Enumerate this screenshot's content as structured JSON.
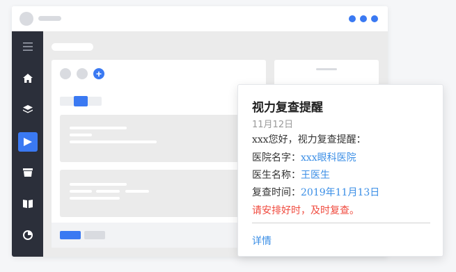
{
  "colors": {
    "accent": "#3a79f2",
    "sidebar_bg": "#2b2f3a",
    "link": "#3a8ee6",
    "warning": "#f04a3e"
  },
  "window": {
    "controls": [
      "dot",
      "dot",
      "dot"
    ]
  },
  "sidebar": {
    "items": [
      {
        "icon": "menu-icon",
        "active": false
      },
      {
        "icon": "home-icon",
        "active": false
      },
      {
        "icon": "layers-icon",
        "active": false
      },
      {
        "icon": "play-icon",
        "active": true
      },
      {
        "icon": "box-icon",
        "active": false
      },
      {
        "icon": "book-icon",
        "active": false
      },
      {
        "icon": "pie-chart-icon",
        "active": false
      }
    ]
  },
  "toolbar": {
    "add_icon": "plus-icon",
    "plus_glyph": "+"
  },
  "notification": {
    "title": "视力复查提醒",
    "date": "11月12日",
    "greeting": "xxx您好，视力复查提醒：",
    "hospital_label": "医院名字：",
    "hospital_value": "xxx眼科医院",
    "doctor_label": "医生名称：",
    "doctor_value": "王医生",
    "time_label": "复查时间：",
    "time_value": "2019年11月13日",
    "warning": "请安排好时，及时复查。",
    "details_link": "详情"
  }
}
